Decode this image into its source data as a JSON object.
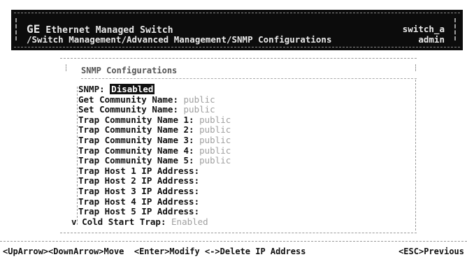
{
  "header": {
    "title_prefix": "GE",
    "title_rest": " Ethernet Managed Switch",
    "path": "/Switch Management/Advanced Management/SNMP Configurations",
    "hostname": "switch_a",
    "user": "admin"
  },
  "panel": {
    "title": "SNMP Configurations"
  },
  "settings": [
    {
      "label": "SNMP:",
      "value": "Disabled"
    },
    {
      "label": "Get Community Name:",
      "value": "public"
    },
    {
      "label": "Set Community Name:",
      "value": "public"
    },
    {
      "label": "Trap Community Name 1:",
      "value": "public"
    },
    {
      "label": "Trap Community Name 2:",
      "value": "public"
    },
    {
      "label": "Trap Community Name 3:",
      "value": "public"
    },
    {
      "label": "Trap Community Name 4:",
      "value": "public"
    },
    {
      "label": "Trap Community Name 5:",
      "value": "public"
    },
    {
      "label": "Trap Host 1 IP Address:",
      "value": ""
    },
    {
      "label": "Trap Host 2 IP Address:",
      "value": ""
    },
    {
      "label": "Trap Host 3 IP Address:",
      "value": ""
    },
    {
      "label": "Trap Host 4 IP Address:",
      "value": ""
    },
    {
      "label": "Trap Host 5 IP Address:",
      "value": ""
    },
    {
      "label": "Cold Start Trap:",
      "value": "Enabled"
    }
  ],
  "scroll_marker": "v",
  "footer": {
    "hints": "<UpArrow><DownArrow>Move  <Enter>Modify <->Delete IP Address",
    "esc": "<ESC>Previous"
  }
}
